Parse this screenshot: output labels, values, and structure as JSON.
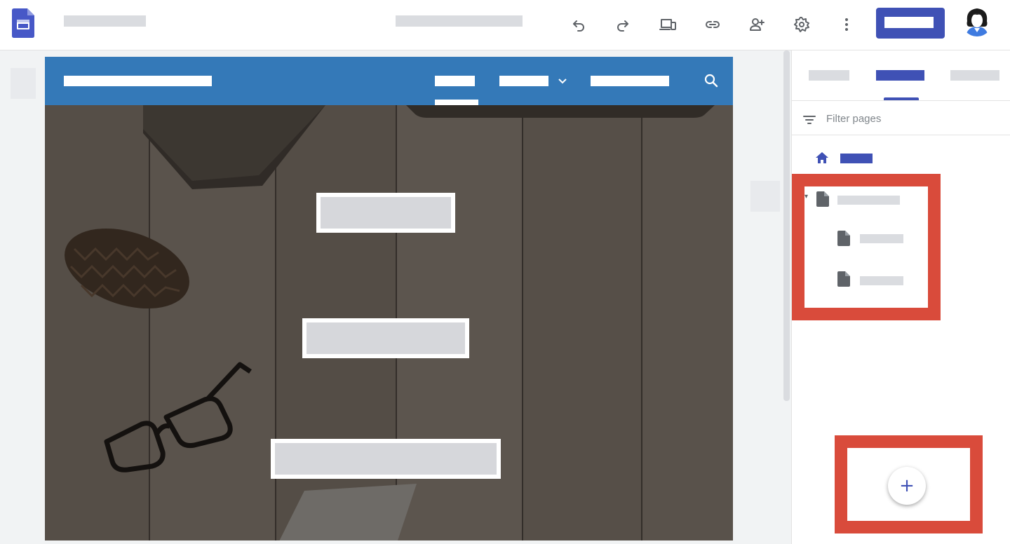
{
  "toolbar": {
    "icons": [
      "undo-icon",
      "redo-icon",
      "device-preview-icon",
      "link-icon",
      "add-person-icon",
      "settings-icon",
      "more-vert-icon"
    ]
  },
  "panel": {
    "filter_placeholder": "Filter pages",
    "add_button_symbol": "+"
  },
  "colors": {
    "accent": "#3f51b5",
    "site_header": "#3479b8",
    "highlight": "#d94b3b"
  }
}
